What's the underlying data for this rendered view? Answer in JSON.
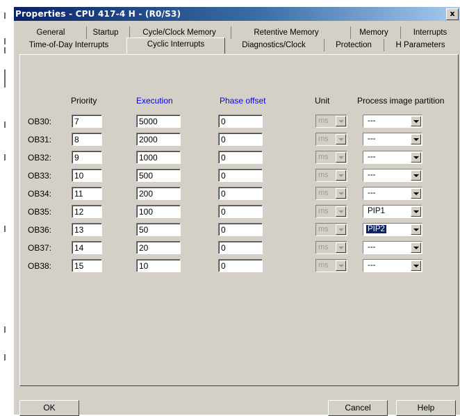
{
  "window": {
    "title": "Properties - CPU 417-4 H - (R0/S3)",
    "close_glyph": "x"
  },
  "tabs_row1": [
    "General",
    "Startup",
    "Cycle/Clock Memory",
    "Retentive Memory",
    "Memory",
    "Interrupts"
  ],
  "tabs_row2": [
    "Time-of-Day Interrupts",
    "Cyclic Interrupts",
    "Diagnostics/Clock",
    "Protection",
    "H Parameters"
  ],
  "active_tab": "Cyclic Interrupts",
  "columns": {
    "priority": "Priority",
    "execution": "Execution",
    "phase_offset": "Phase offset",
    "unit": "Unit",
    "process_image_partition": "Process image partition"
  },
  "rows": [
    {
      "label": "OB30:",
      "priority": "7",
      "execution": "5000",
      "phase_offset": "0",
      "unit": "ms",
      "pip": "---"
    },
    {
      "label": "OB31:",
      "priority": "8",
      "execution": "2000",
      "phase_offset": "0",
      "unit": "ms",
      "pip": "---"
    },
    {
      "label": "OB32:",
      "priority": "9",
      "execution": "1000",
      "phase_offset": "0",
      "unit": "ms",
      "pip": "---"
    },
    {
      "label": "OB33:",
      "priority": "10",
      "execution": "500",
      "phase_offset": "0",
      "unit": "ms",
      "pip": "---"
    },
    {
      "label": "OB34:",
      "priority": "11",
      "execution": "200",
      "phase_offset": "0",
      "unit": "ms",
      "pip": "---"
    },
    {
      "label": "OB35:",
      "priority": "12",
      "execution": "100",
      "phase_offset": "0",
      "unit": "ms",
      "pip": "PIP1"
    },
    {
      "label": "OB36:",
      "priority": "13",
      "execution": "50",
      "phase_offset": "0",
      "unit": "ms",
      "pip": "PIP2"
    },
    {
      "label": "OB37:",
      "priority": "14",
      "execution": "20",
      "phase_offset": "0",
      "unit": "ms",
      "pip": "---"
    },
    {
      "label": "OB38:",
      "priority": "15",
      "execution": "10",
      "phase_offset": "0",
      "unit": "ms",
      "pip": "---"
    }
  ],
  "selected_pip_row": "OB36:",
  "buttons": {
    "ok": "OK",
    "cancel": "Cancel",
    "help": "Help"
  },
  "colors": {
    "title_blue": "#0a246a",
    "column_blue": "#0000ff",
    "dialog_gray": "#d4d0c8"
  },
  "icons": {
    "close": "close-icon",
    "dropdown": "chevron-down-icon"
  }
}
